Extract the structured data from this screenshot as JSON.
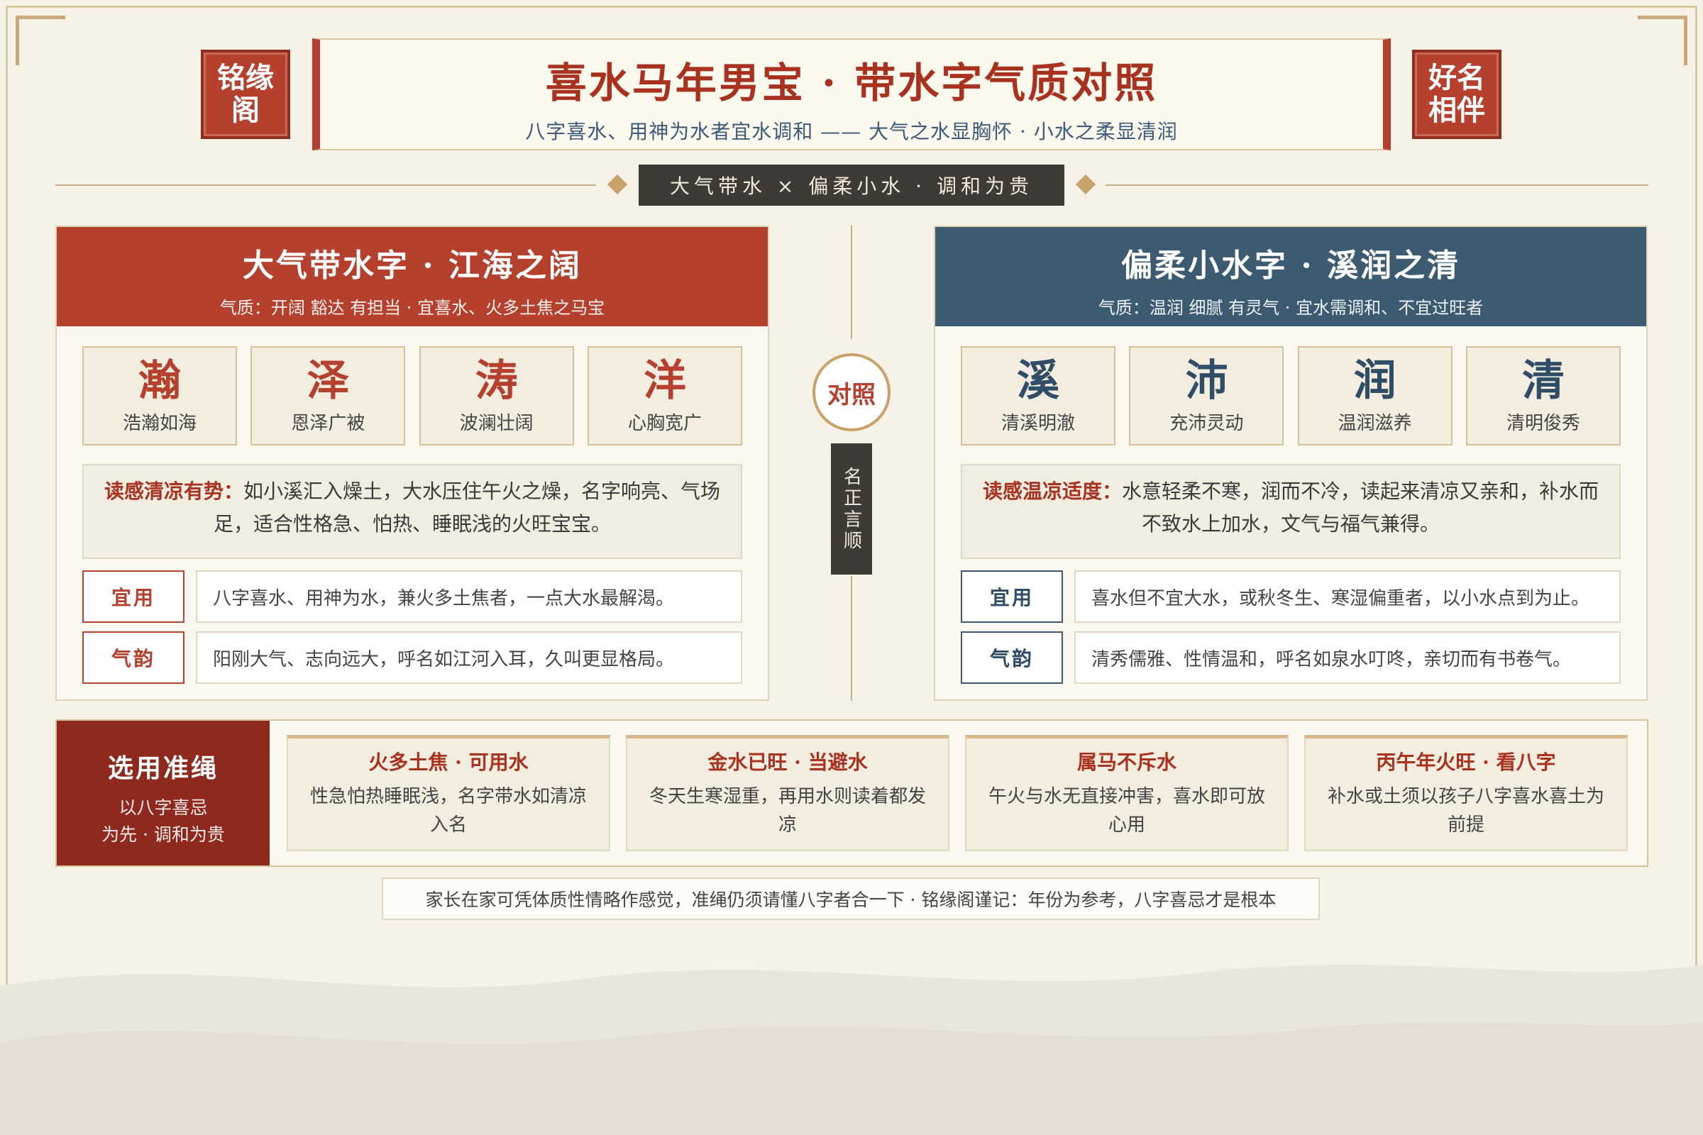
{
  "seals": {
    "left": "铭缘阁",
    "right": "好名相伴"
  },
  "header": {
    "title": "喜水马年男宝 · 带水字气质对照",
    "subtitle": "八字喜水、用神为水者宜水调和 —— 大气之水显胸怀 · 小水之柔显清润"
  },
  "center_tag": "大气带水 × 偏柔小水 · 调和为贵",
  "center": {
    "circle": "对照",
    "vertical": "名正言顺"
  },
  "left_panel": {
    "title": "大气带水字 · 江海之阔",
    "subtitle": "气质：开阔 豁达 有担当 · 宜喜水、火多土焦之马宝",
    "chars": [
      {
        "char": "瀚",
        "phrase": "浩瀚如海"
      },
      {
        "char": "泽",
        "phrase": "恩泽广被"
      },
      {
        "char": "涛",
        "phrase": "波澜壮阔"
      },
      {
        "char": "洋",
        "phrase": "心胸宽广"
      }
    ],
    "desc_label": "读感清凉有势：",
    "desc_text": "如小溪汇入燥土，大水压住午火之燥，名字响亮、气场足，适合性格急、怕热、睡眠浅的火旺宝宝。",
    "rows": [
      {
        "label": "宜用",
        "text": "八字喜水、用神为水，兼火多土焦者，一点大水最解渴。"
      },
      {
        "label": "气韵",
        "text": "阳刚大气、志向远大，呼名如江河入耳，久叫更显格局。"
      }
    ]
  },
  "right_panel": {
    "title": "偏柔小水字 · 溪润之清",
    "subtitle": "气质：温润 细腻 有灵气 · 宜水需调和、不宜过旺者",
    "chars": [
      {
        "char": "溪",
        "phrase": "清溪明澈"
      },
      {
        "char": "沛",
        "phrase": "充沛灵动"
      },
      {
        "char": "润",
        "phrase": "温润滋养"
      },
      {
        "char": "清",
        "phrase": "清明俊秀"
      }
    ],
    "desc_label": "读感温凉适度：",
    "desc_text": "水意轻柔不寒，润而不冷，读起来清凉又亲和，补水而不致水上加水，文气与福气兼得。",
    "rows": [
      {
        "label": "宜用",
        "text": "喜水但不宜大水，或秋冬生、寒湿偏重者，以小水点到为止。"
      },
      {
        "label": "气韵",
        "text": "清秀儒雅、性情温和，呼名如泉水叮咚，亲切而有书卷气。"
      }
    ]
  },
  "criteria": {
    "title": "选用准绳",
    "subtitle_line1": "以八字喜忌",
    "subtitle_line2": "为先 · 调和为贵",
    "cards": [
      {
        "title": "火多土焦 · 可用水",
        "text": "性急怕热睡眠浅，名字带水如清凉入名"
      },
      {
        "title": "金水已旺 · 当避水",
        "text": "冬天生寒湿重，再用水则读着都发凉"
      },
      {
        "title": "属马不斥水",
        "text": "午火与水无直接冲害，喜水即可放心用"
      },
      {
        "title": "丙午年火旺 · 看八字",
        "text": "补水或土须以孩子八字喜水喜土为前提"
      }
    ]
  },
  "footnote": "家长在家可凭体质性情略作感觉，准绳仍须请懂八字者合一下 · 铭缘阁谨记：年份为参考，八字喜忌才是根本",
  "colors": {
    "red": "#b5402d",
    "dark_red": "#8e2a1d",
    "blue": "#3c5a70",
    "gold": "#c9a26a",
    "paper": "#f6f2e7"
  }
}
